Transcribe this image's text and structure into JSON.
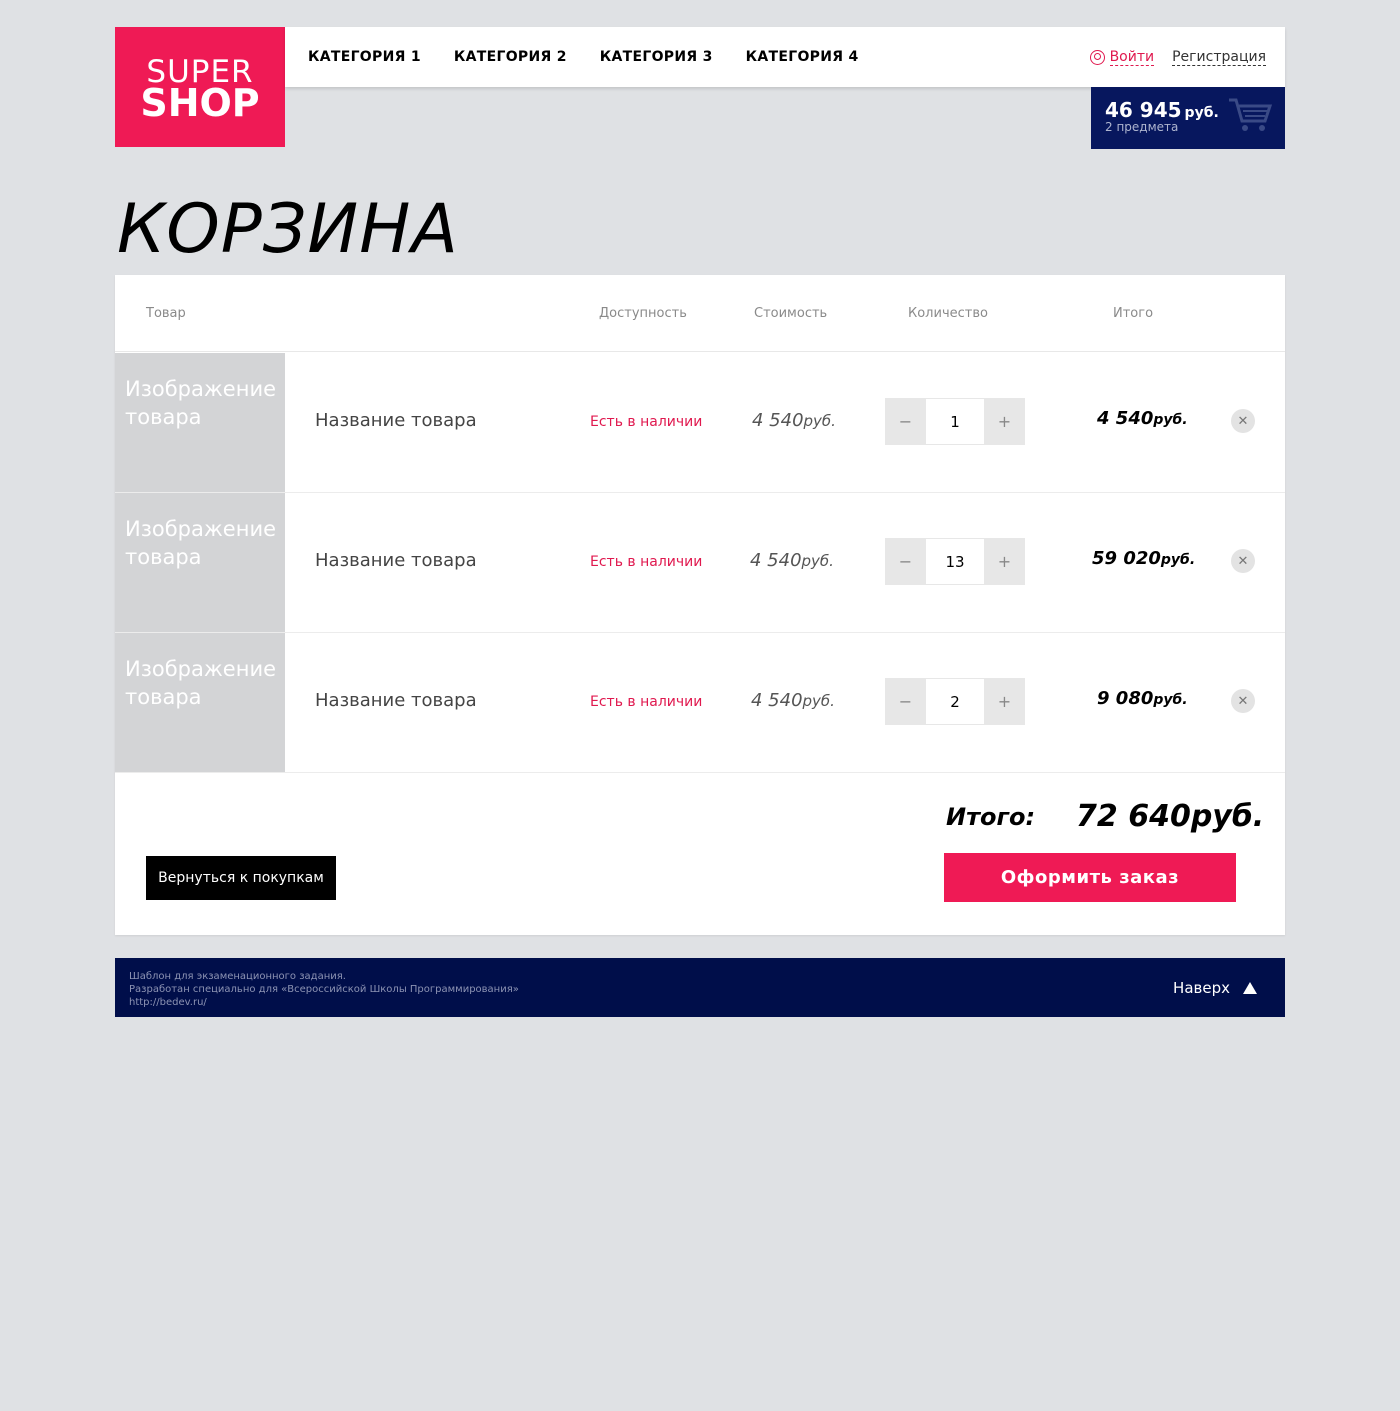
{
  "logo": {
    "line1": "SUPER",
    "line2": "SHOP"
  },
  "nav": [
    "КАТЕГОРИЯ 1",
    "КАТЕГОРИЯ 2",
    "КАТЕГОРИЯ 3",
    "КАТЕГОРИЯ 4"
  ],
  "auth": {
    "login": "Войти",
    "register": "Регистрация"
  },
  "cart": {
    "sum": "46 945",
    "currency": "руб.",
    "count": "2 предмета"
  },
  "page_title": "КОРЗИНА",
  "table": {
    "headers": {
      "product": "Товар",
      "availability": "Доступность",
      "price": "Стоимость",
      "quantity": "Количество",
      "total": "Итого"
    },
    "rows": [
      {
        "image": "Изображение товара",
        "name": "Название товара",
        "availability": "Есть в наличии",
        "price": "4 540",
        "price_cur": "руб.",
        "quantity": "1",
        "total": "4 540",
        "total_cur": "руб."
      },
      {
        "image": "Изображение товара",
        "name": "Название товара",
        "availability": "Есть в наличии",
        "price": "4 540",
        "price_cur": "руб.",
        "quantity": "13",
        "total": "59 020",
        "total_cur": "руб."
      },
      {
        "image": "Изображение товара",
        "name": "Название товара",
        "availability": "Есть в наличии",
        "price": "4 540",
        "price_cur": "руб.",
        "quantity": "2",
        "total": "9 080",
        "total_cur": "руб."
      }
    ]
  },
  "summary": {
    "label": "Итого:",
    "value": "72 640руб."
  },
  "buttons": {
    "back": "Вернуться к покупкам",
    "order": "Оформить заказ"
  },
  "footer": {
    "line1": "Шаблон для экзаменационного задания.",
    "line2": "Разработан специально для «Всероссийской Школы Программирования»",
    "line3": "http://bedev.ru/",
    "up": "Наверх"
  },
  "colors": {
    "accent": "#ef1a55",
    "navy": "#07175e",
    "footer": "#000e4a",
    "background": "#dfe1e4"
  }
}
